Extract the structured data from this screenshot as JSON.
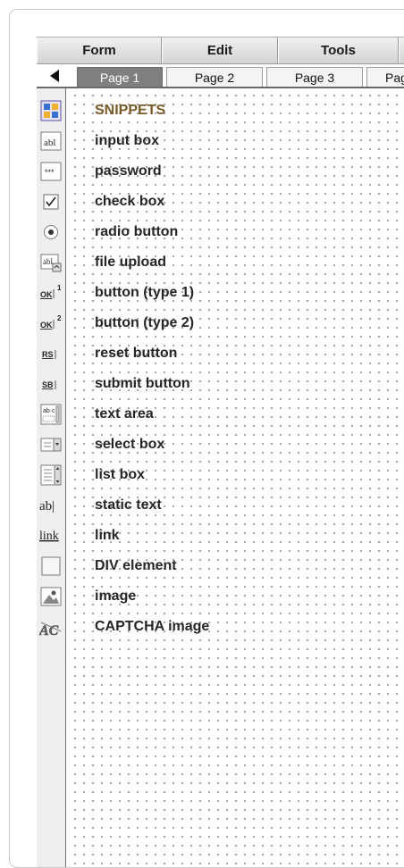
{
  "menubar": {
    "items": [
      {
        "label": "Form"
      },
      {
        "label": "Edit"
      },
      {
        "label": "Tools"
      }
    ]
  },
  "tabs": [
    {
      "label": "Page 1",
      "active": true
    },
    {
      "label": "Page 2",
      "active": false
    },
    {
      "label": "Page 3",
      "active": false
    },
    {
      "label": "Pag",
      "active": false
    }
  ],
  "snippets": [
    {
      "label": "SNIPPETS",
      "icon": "snippets-icon"
    },
    {
      "label": "input box",
      "icon": "input-box-icon"
    },
    {
      "label": "password",
      "icon": "password-icon"
    },
    {
      "label": "check box",
      "icon": "check-box-icon"
    },
    {
      "label": "radio button",
      "icon": "radio-button-icon"
    },
    {
      "label": "file upload",
      "icon": "file-upload-icon"
    },
    {
      "label": "button (type 1)",
      "icon": "button-type-1-icon"
    },
    {
      "label": "button (type 2)",
      "icon": "button-type-2-icon"
    },
    {
      "label": "reset button",
      "icon": "reset-button-icon"
    },
    {
      "label": "submit button",
      "icon": "submit-button-icon"
    },
    {
      "label": "text area",
      "icon": "text-area-icon"
    },
    {
      "label": "select box",
      "icon": "select-box-icon"
    },
    {
      "label": "list box",
      "icon": "list-box-icon"
    },
    {
      "label": "static text",
      "icon": "static-text-icon"
    },
    {
      "label": "link",
      "icon": "link-icon"
    },
    {
      "label": "DIV element",
      "icon": "div-element-icon"
    },
    {
      "label": "image",
      "icon": "image-icon"
    },
    {
      "label": "CAPTCHA image",
      "icon": "captcha-image-icon"
    }
  ],
  "icon_text": {
    "input": "abl",
    "button1": "OK",
    "button1_sup": "1",
    "button2": "OK",
    "button2_sup": "2",
    "reset": "RS",
    "submit": "SB",
    "textarea": "ab·c",
    "static": "ab|",
    "link": "link",
    "password": "***",
    "captcha": "AC"
  },
  "colors": {
    "snippets_header": "#7a5a28",
    "active_tab": "#7f7f7f"
  }
}
